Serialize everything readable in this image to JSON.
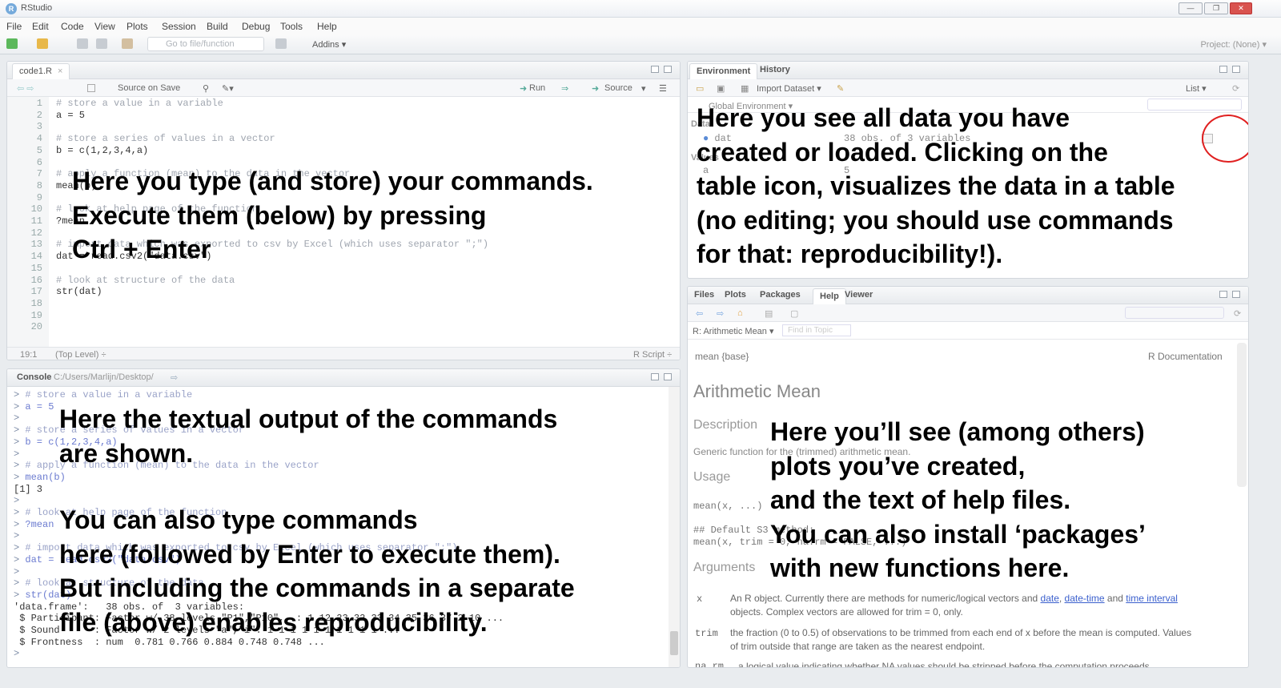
{
  "window": {
    "title": "RStudio",
    "min": "—",
    "max": "❐",
    "close": "✕"
  },
  "menu": [
    "File",
    "Edit",
    "Code",
    "View",
    "Plots",
    "Session",
    "Build",
    "Debug",
    "Tools",
    "Help"
  ],
  "toolbar": {
    "goto_placeholder": "Go to file/function",
    "addins": "Addins ▾",
    "project": "Project: (None) ▾"
  },
  "editor": {
    "tab": "code1.R",
    "tab_close": "×",
    "source_on_save": "Source on Save",
    "run": "Run",
    "source": "Source",
    "lines": [
      {
        "n": "1",
        "t": "# store a value in a variable",
        "c": true
      },
      {
        "n": "2",
        "t": "a = 5",
        "c": false
      },
      {
        "n": "3",
        "t": "",
        "c": false
      },
      {
        "n": "4",
        "t": "# store a series of values in a vector",
        "c": true
      },
      {
        "n": "5",
        "t": "b = c(1,2,3,4,a)",
        "c": false
      },
      {
        "n": "6",
        "t": "",
        "c": false
      },
      {
        "n": "7",
        "t": "# apply a function (mean) to the data in the vector",
        "c": true
      },
      {
        "n": "8",
        "t": "mean(b)",
        "c": false
      },
      {
        "n": "9",
        "t": "",
        "c": false
      },
      {
        "n": "10",
        "t": "# look at help page of the function",
        "c": true
      },
      {
        "n": "11",
        "t": "?mean",
        "c": false
      },
      {
        "n": "12",
        "t": "",
        "c": false
      },
      {
        "n": "13",
        "t": "# import data which was exported to csv by Excel (which uses separator \";\")",
        "c": true
      },
      {
        "n": "14",
        "t": "dat = read.csv2(\"data.csv\")",
        "c": false
      },
      {
        "n": "15",
        "t": "",
        "c": false
      },
      {
        "n": "16",
        "t": "# look at structure of the data",
        "c": true
      },
      {
        "n": "17",
        "t": "str(dat)",
        "c": false
      },
      {
        "n": "18",
        "t": "",
        "c": false
      },
      {
        "n": "19",
        "t": "",
        "c": false
      },
      {
        "n": "20",
        "t": "",
        "c": false
      }
    ],
    "status_pos": "19:1",
    "status_level": "(Top Level) ÷",
    "status_type": "R Script ÷"
  },
  "console": {
    "tab": "Console",
    "path": "C:/Users/Marlijn/Desktop/",
    "lines": [
      {
        "p": ">",
        "t": " # store a value in a variable",
        "k": "cmd"
      },
      {
        "p": ">",
        "t": " a = 5",
        "k": "cmd"
      },
      {
        "p": ">",
        "t": "",
        "k": "cmd"
      },
      {
        "p": ">",
        "t": " # store a series of values in a vector",
        "k": "cmd"
      },
      {
        "p": ">",
        "t": " b = c(1,2,3,4,a)",
        "k": "cmd"
      },
      {
        "p": ">",
        "t": "",
        "k": "cmd"
      },
      {
        "p": ">",
        "t": " # apply a function (mean) to the data in the vector",
        "k": "cmd"
      },
      {
        "p": ">",
        "t": " mean(b)",
        "k": "cmd"
      },
      {
        "p": "",
        "t": "[1] 3",
        "k": "out"
      },
      {
        "p": ">",
        "t": "",
        "k": "cmd"
      },
      {
        "p": ">",
        "t": " # look at help page of the function",
        "k": "cmd"
      },
      {
        "p": ">",
        "t": " ?mean",
        "k": "cmd"
      },
      {
        "p": ">",
        "t": "",
        "k": "cmd"
      },
      {
        "p": ">",
        "t": " # import data which was exported to csv by Excel (which uses separator \";\")",
        "k": "cmd"
      },
      {
        "p": ">",
        "t": " dat = read.csv2(\"data.csv\")",
        "k": "cmd"
      },
      {
        "p": ">",
        "t": "",
        "k": "cmd"
      },
      {
        "p": ">",
        "t": " # look at structure of the data",
        "k": "cmd"
      },
      {
        "p": ">",
        "t": " str(dat)",
        "k": "cmd"
      },
      {
        "p": "",
        "t": "'data.frame':   38 obs. of  3 variables:",
        "k": "out"
      },
      {
        "p": "",
        "t": " $ Participant: Factor w/ 38 levels \"P1\",\"P10\",..: 1 12 23 32 33 34 35 36 37 2 10 ...",
        "k": "out"
      },
      {
        "p": "",
        "t": " $ Sound      : Factor w/ 2 levels \"a\",\"i\": 1 1 1 1 1 1 1 1 1 1 ...",
        "k": "out"
      },
      {
        "p": "",
        "t": " $ Frontness  : num  0.781 0.766 0.884 0.748 0.748 ...",
        "k": "out"
      },
      {
        "p": ">",
        "t": "",
        "k": "cmd"
      }
    ]
  },
  "environment": {
    "tabs": [
      "Environment",
      "History"
    ],
    "import": "Import Dataset ▾",
    "list": "List ▾",
    "global": "Global Environment ▾",
    "section_data": "Data",
    "section_values": "Values",
    "rows": [
      {
        "name": "dat",
        "value": "38 obs. of 3 variables"
      },
      {
        "name": "a",
        "value": "5"
      }
    ]
  },
  "help": {
    "tabs": [
      "Files",
      "Plots",
      "Packages",
      "Help",
      "Viewer"
    ],
    "topic": "R: Arithmetic Mean ▾",
    "find_placeholder": "Find in Topic",
    "header_left": "mean {base}",
    "header_right": "R Documentation",
    "title": "Arithmetic Mean",
    "description_h": "Description",
    "description": "Generic function for the (trimmed) arithmetic mean.",
    "usage_h": "Usage",
    "usage1": "mean(x, ...)",
    "usage2": "## Default S3 method:",
    "usage3": "mean(x, trim = 0, na.rm = FALSE, ...)",
    "arguments_h": "Arguments",
    "arg_x": "x",
    "arg_x_desc1": "An R object. Currently there are methods for numeric/logical vectors and ",
    "link_date": "date",
    "link_datetime": "date-time",
    "link_interval": "time interval",
    "and": " and ",
    "arg_x_desc2": "objects. Complex vectors are allowed for trim = 0, only.",
    "arg_trim": "trim",
    "arg_trim_desc1": "the fraction (0 to 0.5) of observations to be trimmed from each end of x before the mean is computed. Values",
    "arg_trim_desc2": "of trim outside that range are taken as the nearest endpoint.",
    "arg_narm": "na.rm",
    "arg_narm_desc": "a logical value indicating whether NA values should be stripped before the computation proceeds."
  },
  "annotations": {
    "editor": "Here you type (and store) your commands.\nExecute them (below) by pressing\nCtrl + Enter",
    "console_a": "Here the textual output of the commands\nare shown.",
    "console_b": "You can also type commands\nhere (followed by Enter to execute them).\nBut including the commands in a separate\nfile (above) enables reproducibility.",
    "environment": "Here you see all data you have\ncreated or loaded. Clicking on the\ntable icon, visualizes the data in a table\n(no editing; you should use commands\nfor that: reproducibility!).",
    "help": "Here you’ll see (among others)\nplots you’ve created,\nand the text of help files.\nYou can also install ‘packages’\nwith new functions here."
  },
  "colors": {
    "highlight_circle": "#e02020",
    "link": "#3a5fcd",
    "comment": "#a0a6b0"
  }
}
